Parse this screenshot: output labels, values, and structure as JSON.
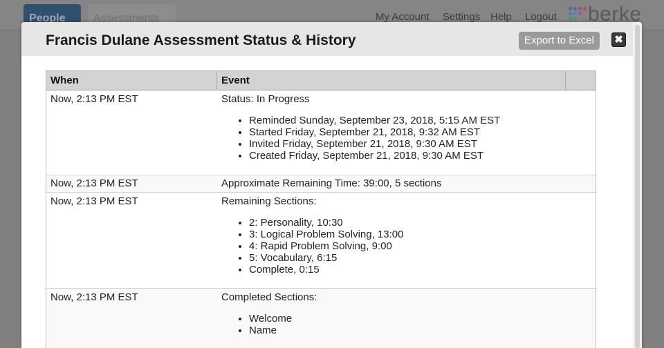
{
  "app": {
    "tabs": [
      {
        "label": "People"
      },
      {
        "label": "Assessments"
      }
    ],
    "nav": [
      {
        "label": "My Account"
      },
      {
        "label": "Settings"
      },
      {
        "label": "Help"
      },
      {
        "label": "Logout"
      }
    ],
    "logo_text": "berke"
  },
  "modal": {
    "title": "Francis Dulane Assessment Status & History",
    "export_label": "Export to Excel",
    "close_glyph": "✖"
  },
  "table": {
    "columns": [
      "When",
      "Event"
    ],
    "rows": [
      {
        "when": "Now, 2:13 PM EST",
        "event": "Status: In Progress",
        "items": [
          "Reminded Sunday, September 23, 2018, 5:15 AM EST",
          "Started Friday, September 21, 2018, 9:32 AM EST",
          "Invited Friday, September 21, 2018, 9:30 AM EST",
          "Created Friday, September 21, 2018, 9:30 AM EST"
        ]
      },
      {
        "when": "Now, 2:13 PM EST",
        "event": "Approximate Remaining Time: 39:00, 5 sections",
        "items": []
      },
      {
        "when": "Now, 2:13 PM EST",
        "event": "Remaining Sections:",
        "items": [
          "2: Personality, 10:30",
          "3: Logical Problem Solving, 13:00",
          "4: Rapid Problem Solving, 9:00",
          "5: Vocabulary, 6:15",
          "Complete, 0:15"
        ]
      },
      {
        "when": "Now, 2:13 PM EST",
        "event": "Completed Sections:",
        "items": [
          "Welcome",
          "Name"
        ]
      }
    ]
  },
  "colors": {
    "header_bg": "#e6e6e6",
    "export_button": "#9a9a9a",
    "table_header": "#d3d3d3",
    "people_tab": "#30506e"
  }
}
